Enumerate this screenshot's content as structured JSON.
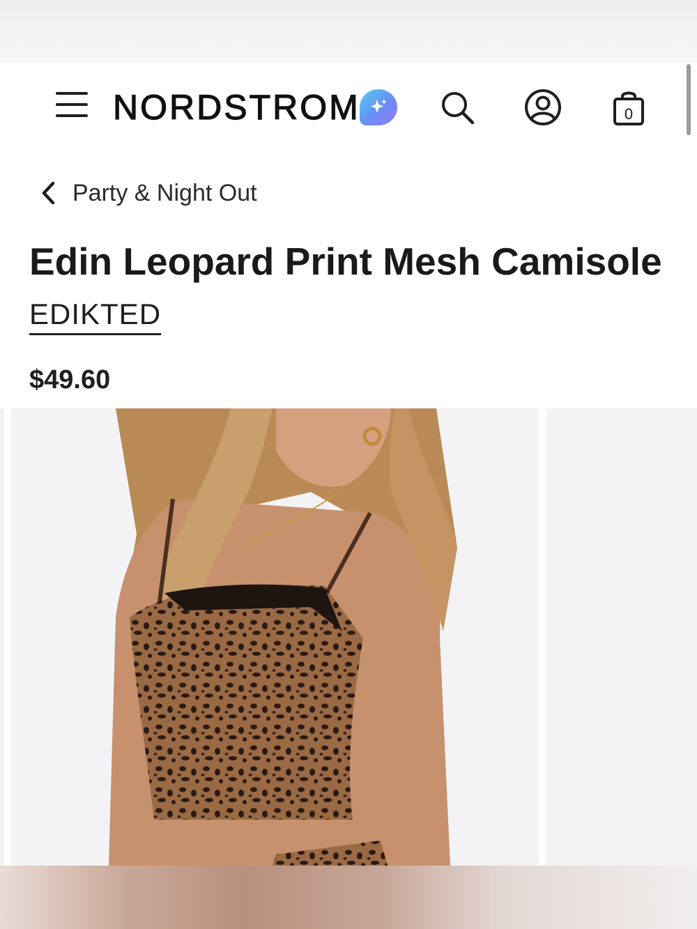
{
  "header": {
    "logo_text": "NORDSTROM",
    "icons": [
      "menu-icon",
      "ai-assistant-icon",
      "search-icon",
      "account-icon",
      "shopping-bag-icon"
    ],
    "bag_count": "0"
  },
  "breadcrumb": {
    "label": "Party & Night Out"
  },
  "product": {
    "title": "Edin Leopard Print Mesh Camisole",
    "brand": "EDIKTED",
    "price": "$49.60"
  },
  "colors": {
    "text": "#1f1f1f",
    "ai_gradient_start": "#4fd0f0",
    "ai_gradient_end": "#9a7cf6",
    "image_background": "#f3f3f5"
  }
}
